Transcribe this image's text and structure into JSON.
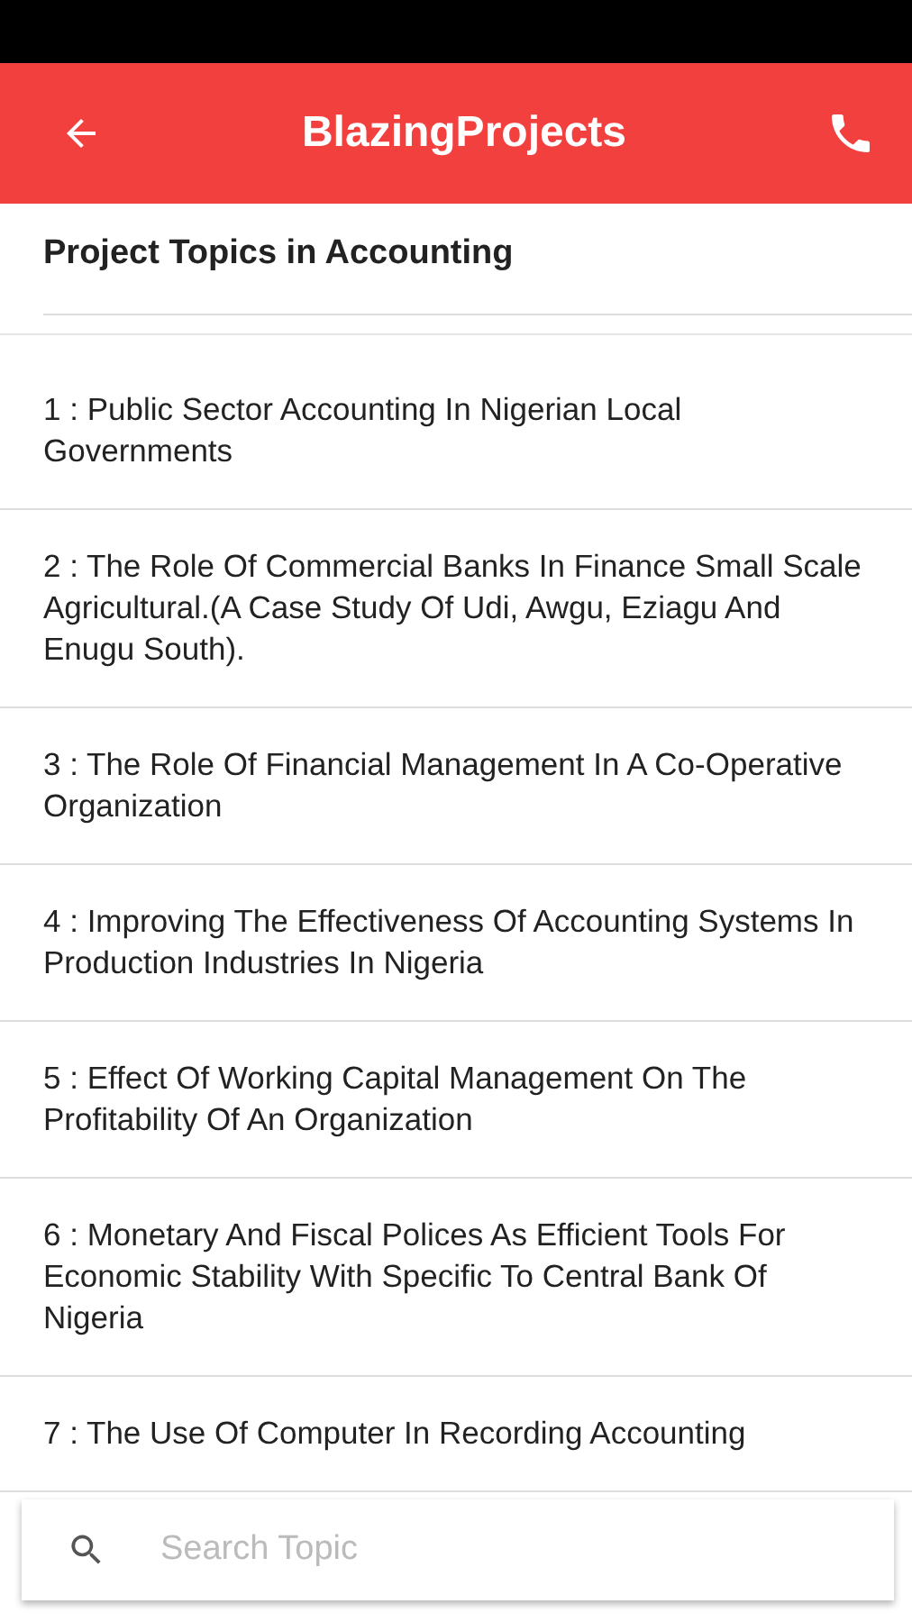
{
  "app_bar": {
    "title": "BlazingProjects"
  },
  "heading": "Project Topics in Accounting",
  "topics": [
    {
      "text": "1 : Public Sector Accounting In Nigerian Local Governments"
    },
    {
      "text": "2 : The Role Of Commercial Banks In Finance Small Scale Agricultural.(A Case Study Of Udi, Awgu, Eziagu And Enugu South)."
    },
    {
      "text": "3 : The Role Of Financial Management In A Co-Operative Organization"
    },
    {
      "text": "4 : Improving The Effectiveness Of Accounting Systems In Production Industries In Nigeria"
    },
    {
      "text": "5 : Effect Of Working Capital Management On The Profitability Of An Organization"
    },
    {
      "text": "6 : Monetary And Fiscal Polices As Efficient Tools For Economic Stability With Specific To Central Bank Of Nigeria"
    },
    {
      "text": "7 : The Use Of Computer In Recording Accounting"
    }
  ],
  "search": {
    "placeholder": "Search Topic"
  }
}
